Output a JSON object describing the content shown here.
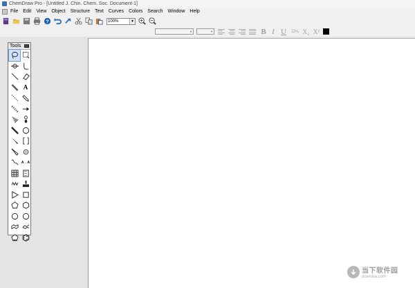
{
  "window": {
    "title": "ChemDraw Pro - [Untitled J. Chin. Chem. Soc. Document-1]"
  },
  "menu": [
    {
      "id": "file",
      "label": "File"
    },
    {
      "id": "edit",
      "label": "Edit"
    },
    {
      "id": "view",
      "label": "View"
    },
    {
      "id": "object",
      "label": "Object"
    },
    {
      "id": "structure",
      "label": "Structure"
    },
    {
      "id": "text",
      "label": "Text"
    },
    {
      "id": "curves",
      "label": "Curves"
    },
    {
      "id": "colors",
      "label": "Colors"
    },
    {
      "id": "search",
      "label": "Search"
    },
    {
      "id": "window",
      "label": "Window"
    },
    {
      "id": "help",
      "label": "Help"
    }
  ],
  "toolbar": {
    "zoom_value": "100%",
    "icons": [
      "new-document-icon",
      "open-folder-icon",
      "save-icon",
      "print-icon",
      "help-icon",
      "undo-icon",
      "redo-icon",
      "cut-icon",
      "copy-icon",
      "paste-icon",
      "zoom-in-icon",
      "zoom-out-icon"
    ]
  },
  "format_bar": {
    "bold": "B",
    "italic": "I",
    "underline": "U",
    "chem_style": "CH₂",
    "subscript": "X₂",
    "superscript": "X²",
    "current_color": "#000000"
  },
  "tools": {
    "title": "Tools",
    "selected": "lasso-tool",
    "items": [
      "lasso-tool",
      "marquee-tool",
      "mass-fragmentation-tool",
      "bond-cleavage-tool",
      "solid-bond-tool",
      "eraser-tool",
      "multiple-bond-tool",
      "text-tool",
      "dashed-bond-tool",
      "pen-tool",
      "hashed-bond-tool",
      "arrow-tool",
      "hashed-wedge-bond-tool",
      "orbital-tool",
      "bold-bond-tool",
      "drawing-elements-tool",
      "wedge-bond-tool",
      "bracket-tool",
      "hollow-wedge-bond-tool",
      "chemical-symbol-tool",
      "wavy-bond-tool",
      "atom-map-tool",
      "table-tool",
      "tlc-plate-tool",
      "chain-tool",
      "templates-tool",
      "cyclopropane-tool",
      "cyclobutane-tool",
      "cyclopentane-tool",
      "cyclohexane-tool",
      "cycloheptane-tool",
      "cyclooctane-tool",
      "chair-cyclohexane-tool-1",
      "chair-cyclohexane-tool-2",
      "cyclopentadiene-tool",
      "benzene-tool"
    ],
    "text_tool_label": "A",
    "atom_map_label": "A→A"
  },
  "watermark": {
    "brand_text": "当下软件园",
    "url": "downxia.com"
  }
}
